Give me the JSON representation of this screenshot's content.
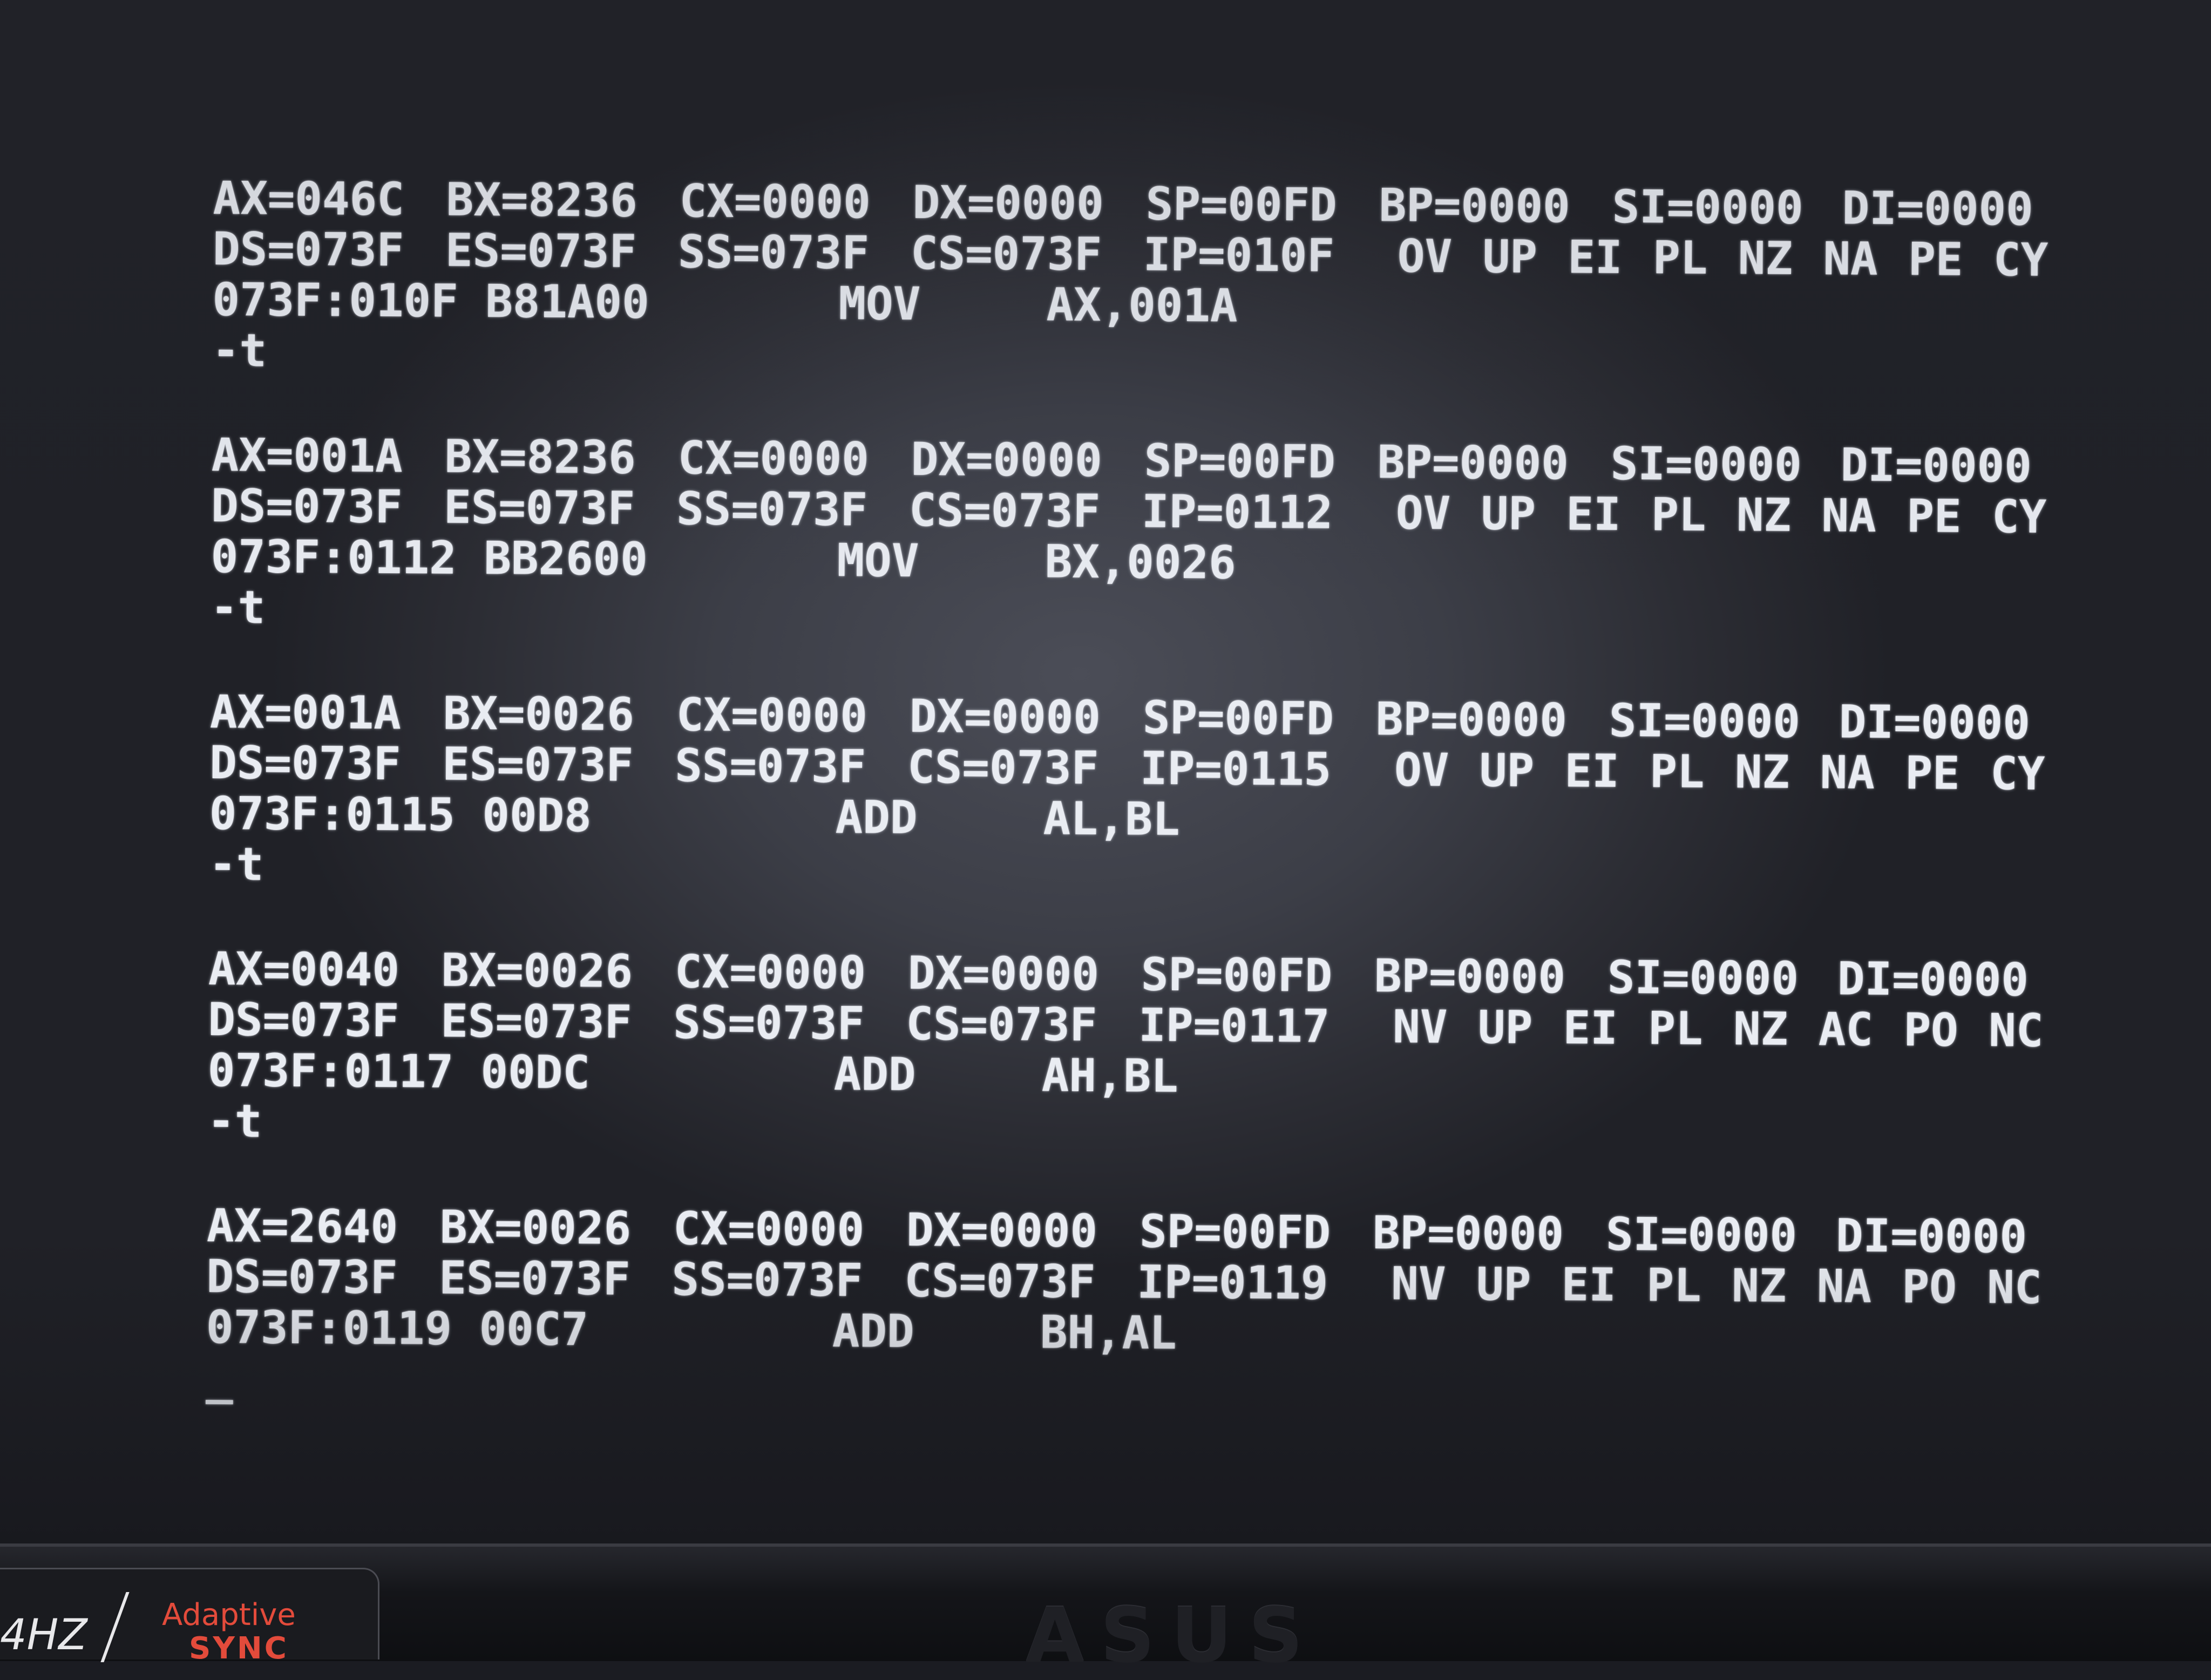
{
  "terminal": {
    "blocks": [
      {
        "regs1": [
          "AX=046C",
          "BX=8236",
          "CX=0000",
          "DX=0000",
          "SP=00FD",
          "BP=0000",
          "SI=0000",
          "DI=0000"
        ],
        "regs2": [
          "DS=073F",
          "ES=073F",
          "SS=073F",
          "CS=073F",
          "IP=010F"
        ],
        "flags": "OV UP EI PL NZ NA PE CY",
        "address": "073F:010F B81A00",
        "mnemonic": "MOV",
        "operands": "AX,001A",
        "prompt": "-t"
      },
      {
        "regs1": [
          "AX=001A",
          "BX=8236",
          "CX=0000",
          "DX=0000",
          "SP=00FD",
          "BP=0000",
          "SI=0000",
          "DI=0000"
        ],
        "regs2": [
          "DS=073F",
          "ES=073F",
          "SS=073F",
          "CS=073F",
          "IP=0112"
        ],
        "flags": "OV UP EI PL NZ NA PE CY",
        "address": "073F:0112 BB2600",
        "mnemonic": "MOV",
        "operands": "BX,0026",
        "prompt": "-t"
      },
      {
        "regs1": [
          "AX=001A",
          "BX=0026",
          "CX=0000",
          "DX=0000",
          "SP=00FD",
          "BP=0000",
          "SI=0000",
          "DI=0000"
        ],
        "regs2": [
          "DS=073F",
          "ES=073F",
          "SS=073F",
          "CS=073F",
          "IP=0115"
        ],
        "flags": "OV UP EI PL NZ NA PE CY",
        "address": "073F:0115 00D8",
        "mnemonic": "ADD",
        "operands": "AL,BL",
        "prompt": "-t"
      },
      {
        "regs1": [
          "AX=0040",
          "BX=0026",
          "CX=0000",
          "DX=0000",
          "SP=00FD",
          "BP=0000",
          "SI=0000",
          "DI=0000"
        ],
        "regs2": [
          "DS=073F",
          "ES=073F",
          "SS=073F",
          "CS=073F",
          "IP=0117"
        ],
        "flags": "NV UP EI PL NZ AC PO NC",
        "address": "073F:0117 00DC",
        "mnemonic": "ADD",
        "operands": "AH,BL",
        "prompt": "-t"
      },
      {
        "regs1": [
          "AX=2640",
          "BX=0026",
          "CX=0000",
          "DX=0000",
          "SP=00FD",
          "BP=0000",
          "SI=0000",
          "DI=0000"
        ],
        "regs2": [
          "DS=073F",
          "ES=073F",
          "SS=073F",
          "CS=073F",
          "IP=0119"
        ],
        "flags": "NV UP EI PL NZ NA PO NC",
        "address": "073F:0119 00C7",
        "mnemonic": "ADD",
        "operands": "BH,AL",
        "prompt": "_"
      }
    ]
  },
  "bezel": {
    "logo": "ASUS",
    "sticker_hz": "4HZ",
    "sticker_adaptive": "Adaptive",
    "sticker_sync": "SYNC"
  }
}
